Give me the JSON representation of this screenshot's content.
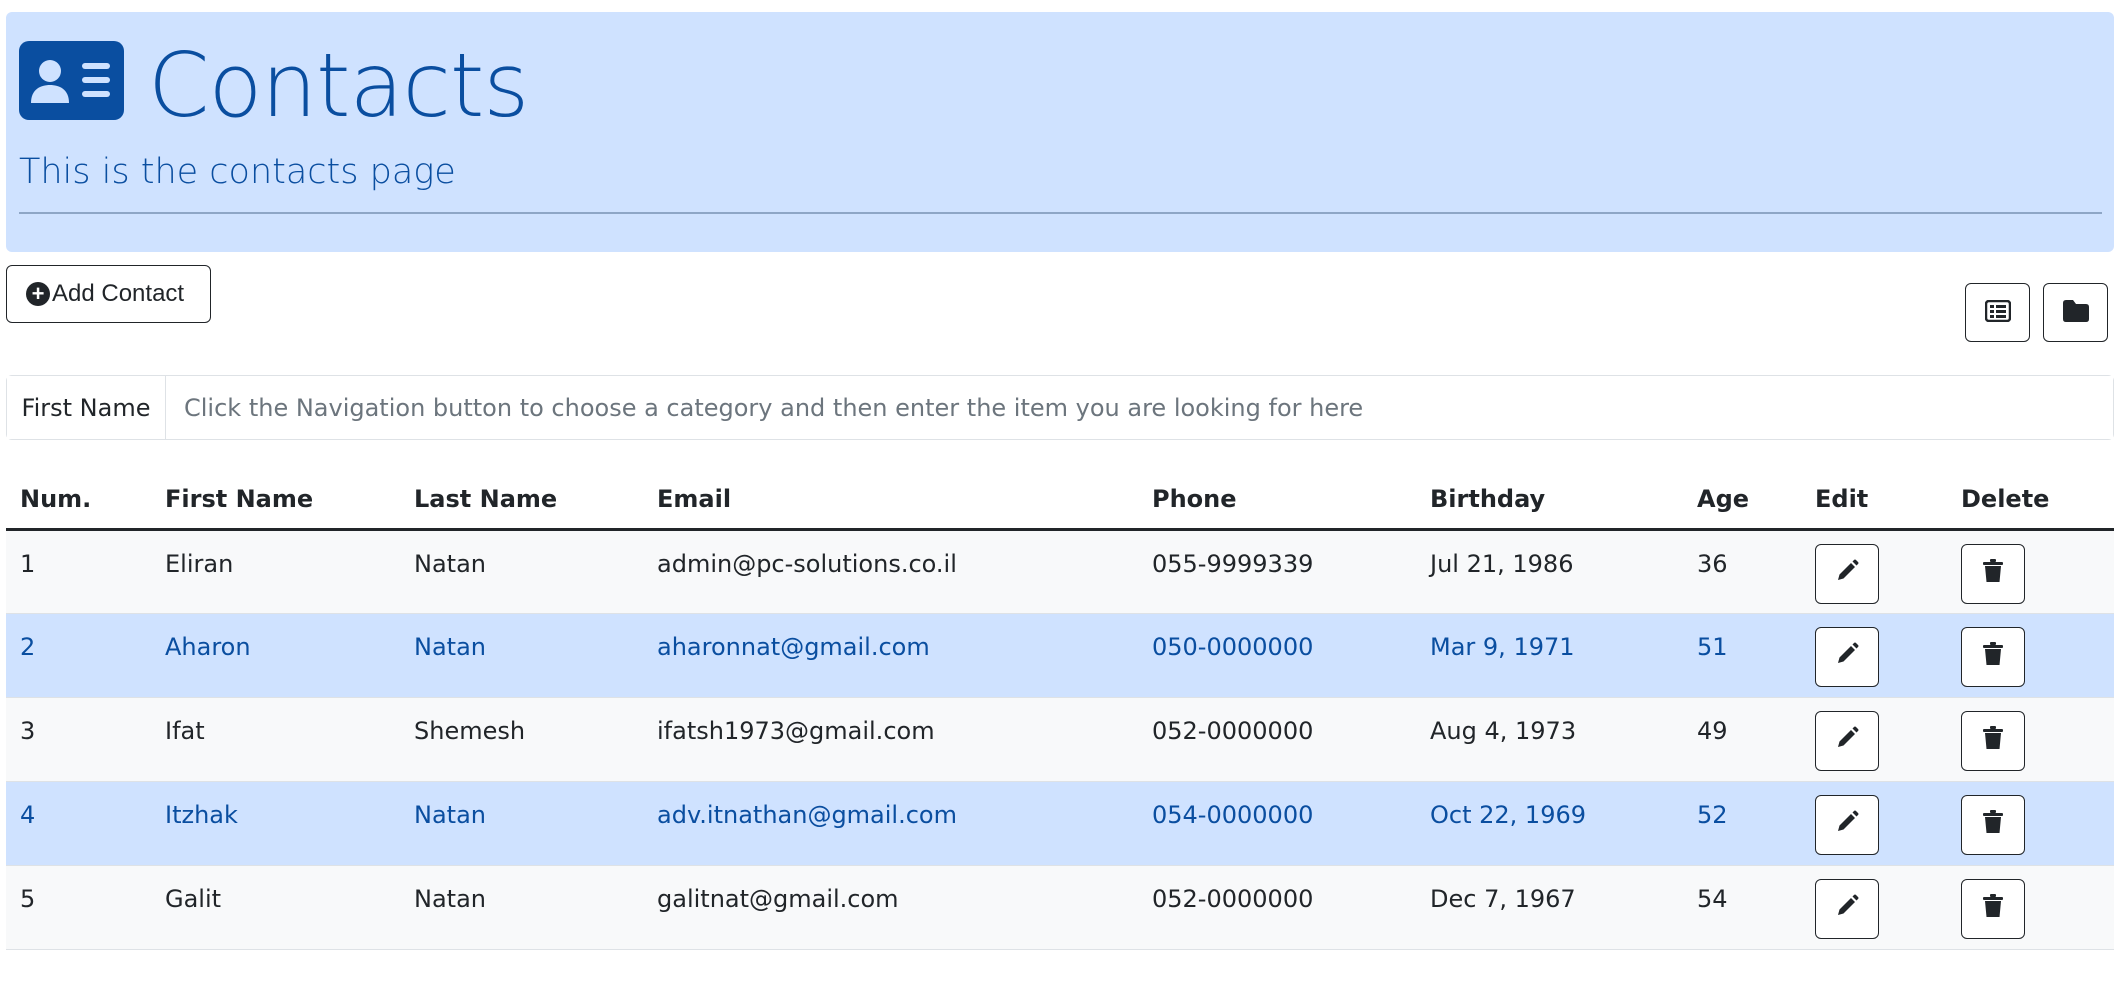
{
  "header": {
    "icon": "contact-card-icon",
    "title": "Contacts",
    "subtitle": "This is the contacts page"
  },
  "toolbar": {
    "add_label": "Add Contact",
    "add_icon": "plus-circle-icon",
    "view_buttons": [
      "table-view-icon",
      "folder-icon"
    ]
  },
  "search": {
    "category_label": "First Name",
    "placeholder": "Click the Navigation button to choose a category and then enter the item you are looking for here",
    "value": ""
  },
  "table": {
    "columns": [
      "Num.",
      "First Name",
      "Last Name",
      "Email",
      "Phone",
      "Birthday",
      "Age",
      "Edit",
      "Delete"
    ],
    "rows": [
      {
        "num": "1",
        "first": "Eliran",
        "last": "Natan",
        "email": "admin@pc-solutions.co.il",
        "phone": "055-9999339",
        "birthday": "Jul 21, 1986",
        "age": "36"
      },
      {
        "num": "2",
        "first": "Aharon",
        "last": "Natan",
        "email": "aharonnat@gmail.com",
        "phone": "050-0000000",
        "birthday": "Mar 9, 1971",
        "age": "51"
      },
      {
        "num": "3",
        "first": "Ifat",
        "last": "Shemesh",
        "email": "ifatsh1973@gmail.com",
        "phone": "052-0000000",
        "birthday": "Aug 4, 1973",
        "age": "49"
      },
      {
        "num": "4",
        "first": "Itzhak",
        "last": "Natan",
        "email": "adv.itnathan@gmail.com",
        "phone": "054-0000000",
        "birthday": "Oct 22, 1969",
        "age": "52"
      },
      {
        "num": "5",
        "first": "Galit",
        "last": "Natan",
        "email": "galitnat@gmail.com",
        "phone": "052-0000000",
        "birthday": "Dec 7, 1967",
        "age": "54"
      }
    ]
  },
  "colors": {
    "primary_light": "#cfe2ff",
    "primary_dark": "#0a4ea0",
    "striped_row": "#f8f9fa"
  }
}
